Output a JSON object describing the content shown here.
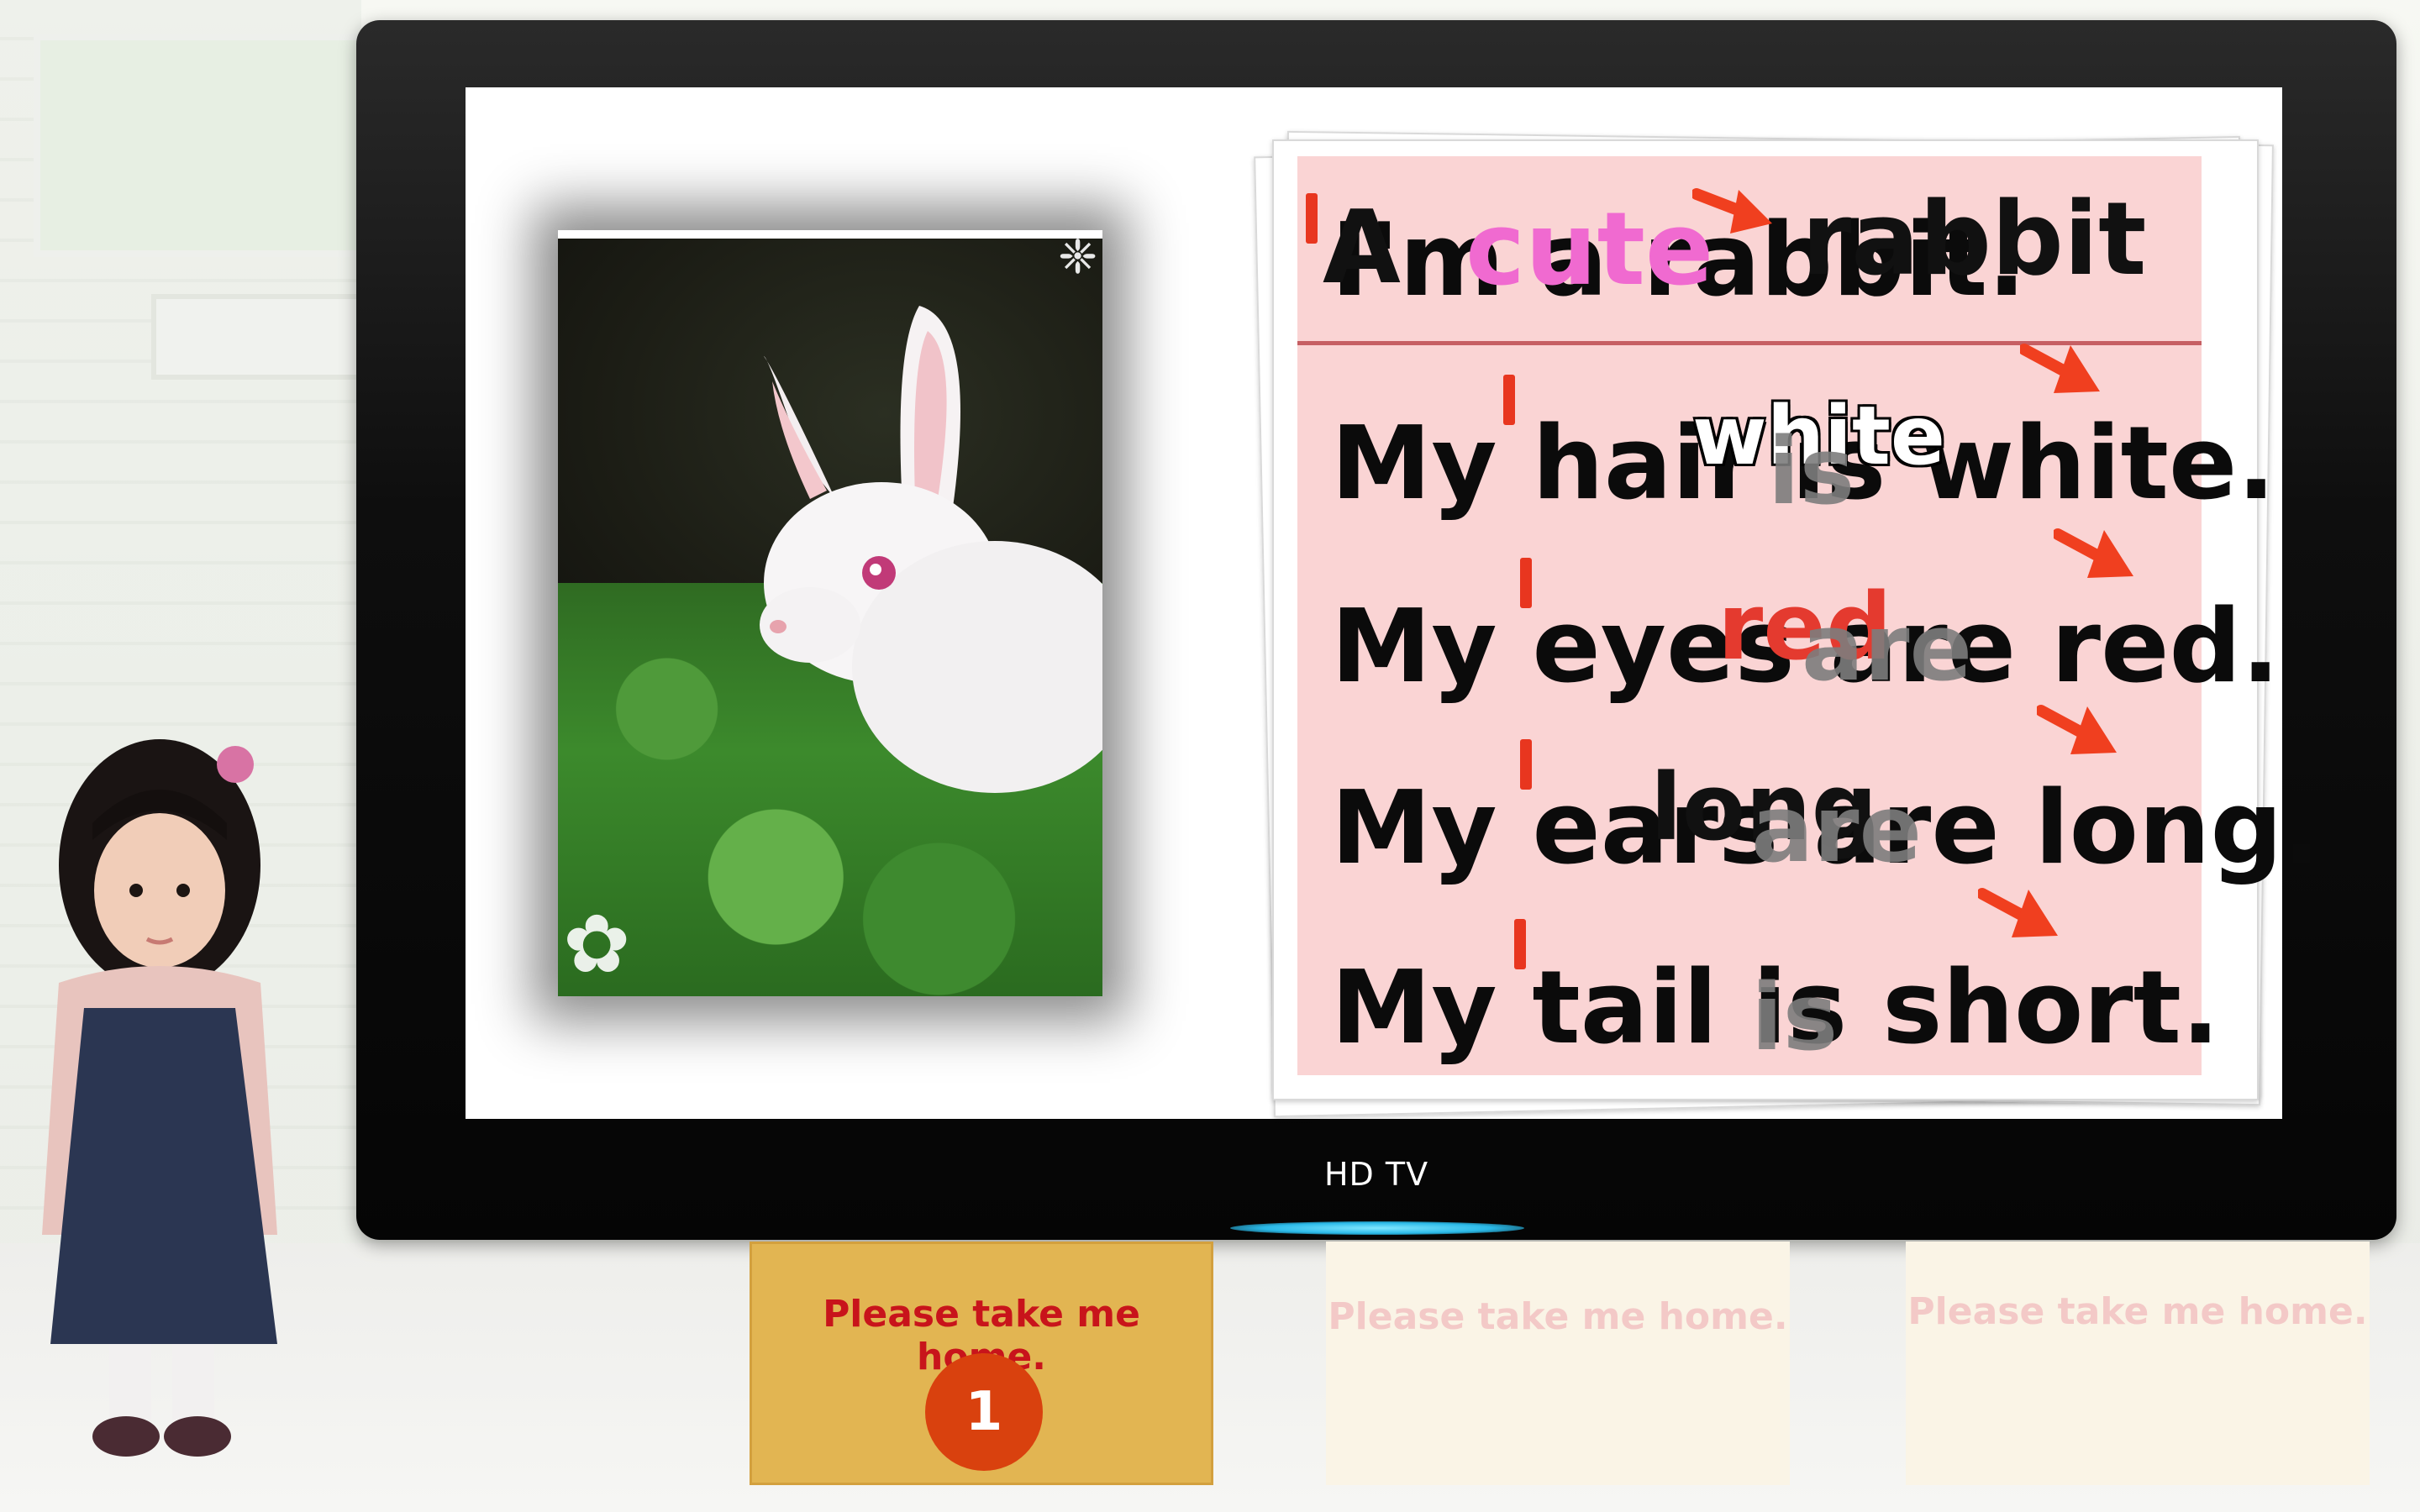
{
  "tv": {
    "brand": "HD TV"
  },
  "worksheet": {
    "lines": [
      {
        "text": "I'm a rabbit."
      },
      {
        "text": "My hair is white."
      },
      {
        "text": "My eyes are red."
      },
      {
        "text": "My ears are long."
      },
      {
        "text": "My tail is short."
      }
    ],
    "overlay_words": {
      "title_start": "A",
      "title_adjective": "cute",
      "title_noun": "rabbit",
      "hair_color": "white",
      "hair_verb": "is",
      "eyes_color": "red",
      "eyes_verb": "are",
      "ears_adjective": "long",
      "ears_verb": "are",
      "tail_verb": "is"
    }
  },
  "cards": [
    {
      "label": "Please take me home.",
      "badge": "1",
      "state": "active"
    },
    {
      "label": "Please take me home.",
      "state": "faded"
    },
    {
      "label": "Please take me home.",
      "state": "faded"
    }
  ],
  "colors": {
    "accent_pink": "#f06ad0",
    "stress_red": "#e8361f",
    "card_gold": "#e2b552",
    "badge_orange": "#d9410e"
  },
  "icons": [
    "arrow-icon",
    "stress-mark-icon",
    "lace-ornament-icon"
  ]
}
